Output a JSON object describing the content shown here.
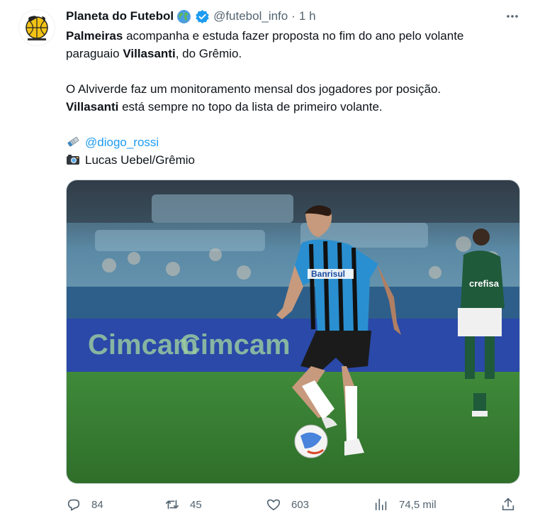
{
  "tweet": {
    "author_name": "Planeta do Futebol",
    "handle": "@futebol_info",
    "separator": "·",
    "time": "1 h",
    "line1_bold": "Palmeiras",
    "line1_rest": " acompanha e estuda fazer proposta no fim do ano pelo volante",
    "line2_start": "paraguaio ",
    "line2_bold": "Villasanti",
    "line2_rest": ", do Grêmio.",
    "line3": "O Alviverde faz um monitoramento mensal dos jogadores por posição.",
    "line4_bold": "Villasanti",
    "line4_rest": " está sempre no topo da lista de primeiro volante.",
    "credit_mention": "@diogo_rossi",
    "credit_photo": "Lucas Uebel/Grêmio"
  },
  "media": {
    "board_text_left": "Cimcam",
    "board_text_mid": "Cimcam",
    "sponsor_text": "Banrisul",
    "opponent_sponsor": "crefisa"
  },
  "actions": {
    "replies": "84",
    "reposts": "45",
    "likes": "603",
    "views": "74,5 mil"
  },
  "colors": {
    "accent": "#1d9bf0",
    "muted": "#536471",
    "text": "#0f1419",
    "verified": "#1d9bf0"
  },
  "icons": [
    "globe-icon",
    "verified-badge-icon",
    "more-icon",
    "paperclip-icon",
    "camera-icon",
    "reply-icon",
    "repost-icon",
    "like-icon",
    "views-icon",
    "share-icon"
  ]
}
